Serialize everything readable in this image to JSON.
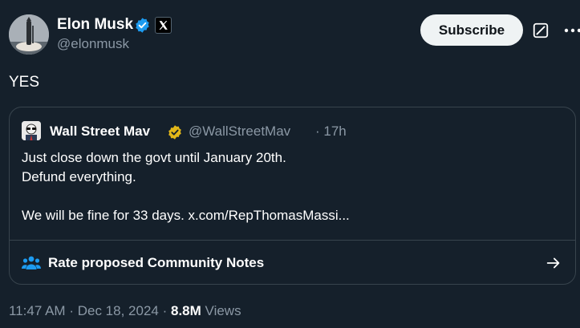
{
  "author": {
    "name": "Elon Musk",
    "handle": "@elonmusk",
    "verified_icon": "blue-check-icon",
    "affiliate_icon": "x-logo-icon"
  },
  "actions": {
    "subscribe_label": "Subscribe",
    "grok_icon": "grok-icon",
    "more_icon": "more-icon"
  },
  "tweet": {
    "text": "YES"
  },
  "quote": {
    "name": "Wall Street Mav",
    "handle": "@WallStreetMav",
    "time": "· 17h",
    "verified_icon": "gold-check-icon",
    "lines": [
      "Just close down the govt until January 20th.",
      "Defund everything.",
      "",
      "We will be fine for 33 days. x.com/RepThomasMassi..."
    ]
  },
  "community_notes": {
    "label": "Rate proposed Community Notes",
    "icon": "people-icon",
    "arrow_icon": "arrow-right-icon"
  },
  "meta": {
    "time": "11:47 AM",
    "date": "Dec 18, 2024",
    "separator": "·",
    "views_count": "8.8M",
    "views_label": "Views"
  },
  "colors": {
    "background": "#15202b",
    "border": "#38444d",
    "muted_text": "#8b98a5",
    "accent_blue": "#1d9bf0",
    "gold": "#e2b719",
    "button_bg": "#eff3f4"
  }
}
